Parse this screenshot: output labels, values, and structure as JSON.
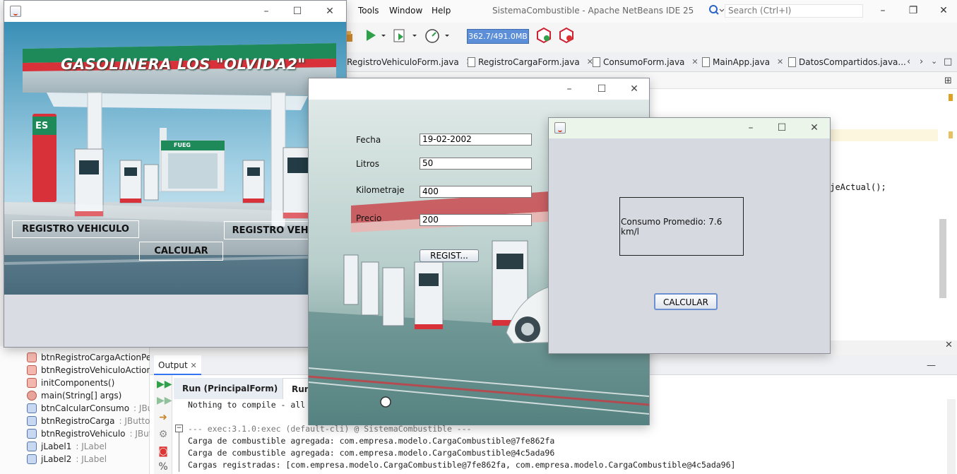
{
  "ide": {
    "menu": [
      "Tools",
      "Window",
      "Help"
    ],
    "title": "SistemaCombustible - Apache NetBeans IDE 25",
    "search_placeholder": "Search (Ctrl+I)",
    "memory": "362.7/491.0MB",
    "editor_tabs": [
      {
        "label": "RegistroVehiculoForm.java"
      },
      {
        "label": "RegistroCargaForm.java"
      },
      {
        "label": "ConsumoForm.java"
      },
      {
        "label": "MainApp.java"
      },
      {
        "label": "DatosCompartidos.java..."
      }
    ],
    "code_fragment": "ajeActual();",
    "navigator": [
      {
        "name": "btnRegistroCargaActionPe",
        "type": "",
        "icon": "method-icon"
      },
      {
        "name": "btnRegistroVehiculoAction",
        "type": "",
        "icon": "method-icon"
      },
      {
        "name": "initComponents()",
        "type": "",
        "icon": "method-icon"
      },
      {
        "name": "main(String[] args)",
        "type": "",
        "icon": "main-method-icon"
      },
      {
        "name": "btnCalcularConsumo",
        "type": " : JBu",
        "icon": "field-icon"
      },
      {
        "name": "btnRegistroCarga",
        "type": " : JButton",
        "icon": "field-icon"
      },
      {
        "name": "btnRegistroVehiculo",
        "type": " : JBut",
        "icon": "field-icon"
      },
      {
        "name": "jLabel1",
        "type": " : JLabel",
        "icon": "field-icon"
      },
      {
        "name": "jLabel2",
        "type": " : JLabel",
        "icon": "field-icon"
      }
    ],
    "output": {
      "tab_label": "Output",
      "run_tabs": [
        "Run (PrincipalForm)",
        "Run"
      ],
      "lines": [
        {
          "text": "Nothing to compile - all",
          "style": "normal"
        },
        {
          "text": "",
          "style": "normal"
        },
        {
          "text": "--- exec:3.1.0:exec (default-cli) @ SistemaCombustible ---",
          "style": "gray"
        },
        {
          "text": "Carga de combustible agregada: com.empresa.modelo.CargaCombustible@7fe862fa",
          "style": "normal"
        },
        {
          "text": "Carga de combustible agregada: com.empresa.modelo.CargaCombustible@4c5ada96",
          "style": "normal"
        },
        {
          "text": "Cargas registradas: [com.empresa.modelo.CargaCombustible@7fe862fa, com.empresa.modelo.CargaCombustible@4c5ada96]",
          "style": "normal"
        }
      ]
    }
  },
  "principal_window": {
    "title": "GASOLINERA LOS \"OLVIDA2\"",
    "btn_registro_vehiculo_left": "REGISTRO VEHICULO",
    "btn_registro_vehiculo_right": "REGISTRO VEHICULO",
    "btn_calcular": "CALCULAR",
    "station_sign": "ES",
    "shop_sign": "FUEG"
  },
  "carga_window": {
    "fields": [
      {
        "label": "Fecha",
        "value": "19-02-2002"
      },
      {
        "label": "Litros",
        "value": "50"
      },
      {
        "label": "Kilometraje",
        "value": "400"
      },
      {
        "label": "Precio",
        "value": "200"
      }
    ],
    "button": "REGIST..."
  },
  "consumo_window": {
    "result": "Consumo Promedio: 7.6 km/l",
    "button": "CALCULAR"
  },
  "colors": {
    "memory_meter": "#5c8fd8",
    "station_red": "#d8313a",
    "station_green": "#1e8a5a",
    "window_bg": "#d9dce3",
    "consumo_titlebar": "#ecf5e9"
  }
}
